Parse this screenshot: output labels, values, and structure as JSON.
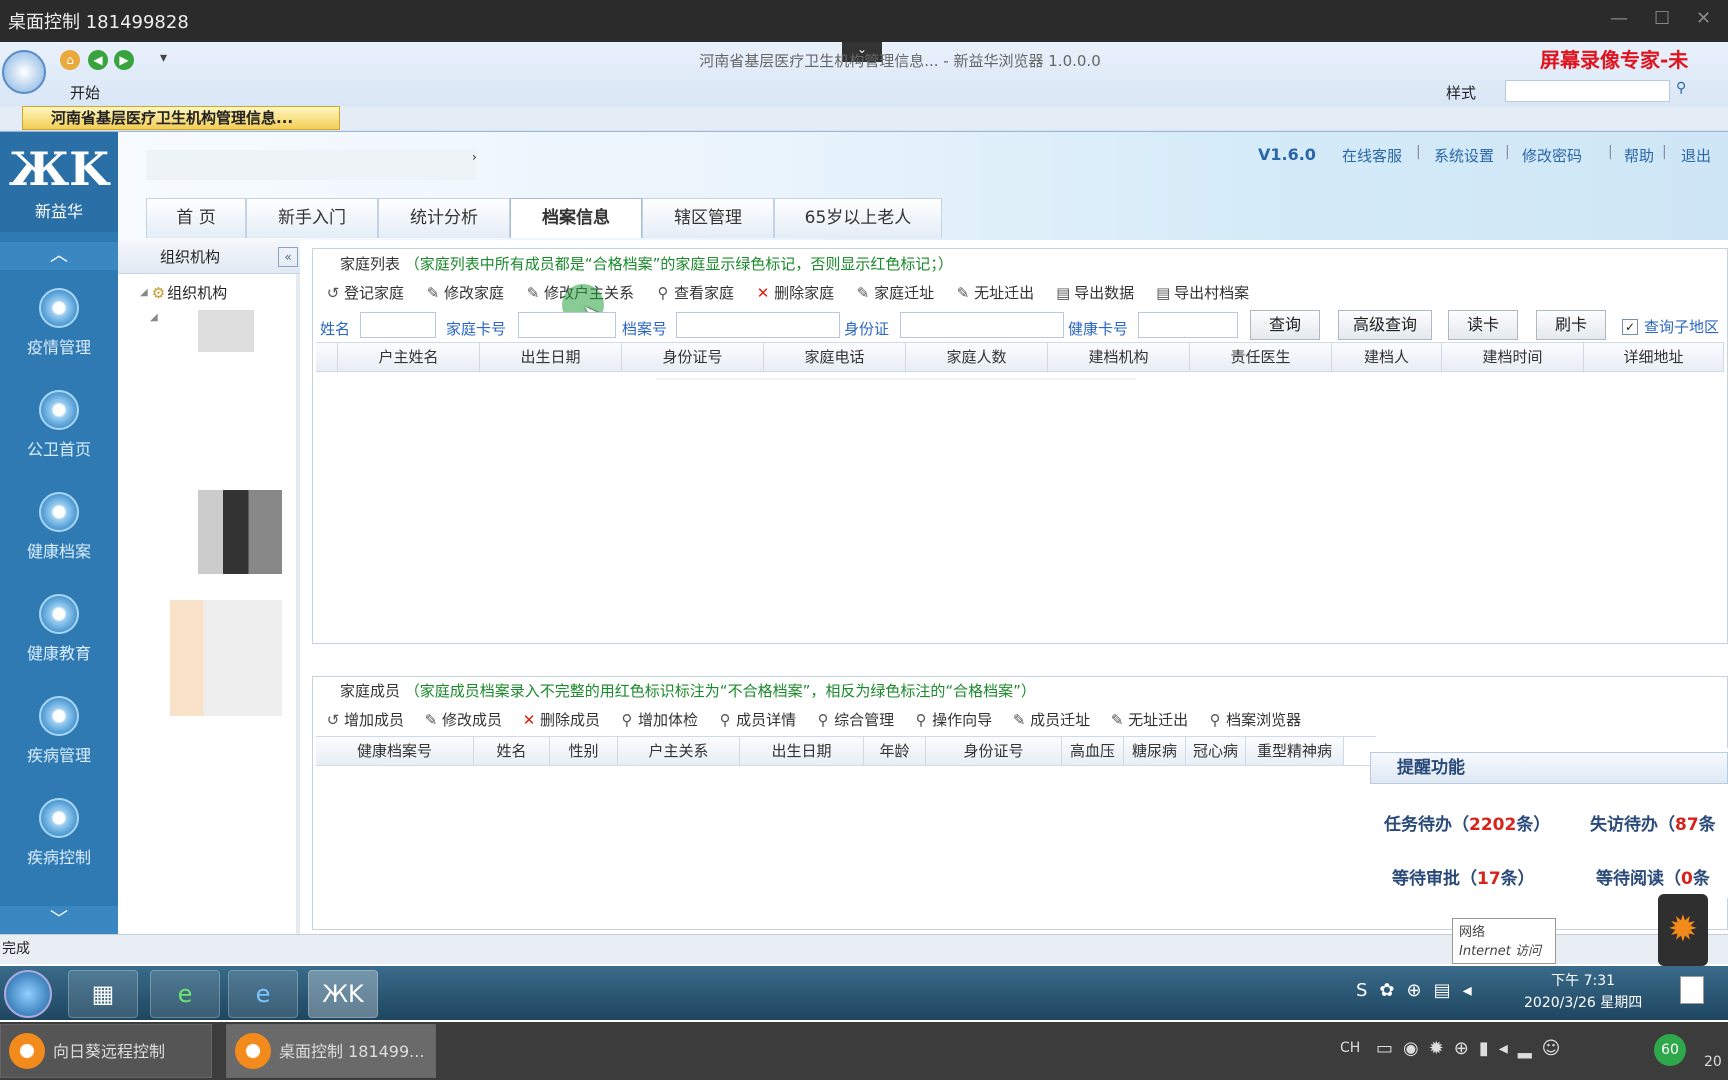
{
  "remote_title": "桌面控制 181499828",
  "browser": {
    "page_title": "河南省基层医疗卫生机构管理信息... - 新益华浏览器 1.0.0.0",
    "start_label": "开始",
    "style_label": "样式",
    "doc_tab": "河南省基层医疗卫生机构管理信息...",
    "recorder_watermark": "屏幕录像专家-未"
  },
  "app": {
    "version": "V1.6.0",
    "top_links": [
      "在线客服",
      "系统设置",
      "修改密码",
      "帮助",
      "退出"
    ],
    "logo_name": "新益华",
    "tabs": [
      "首 页",
      "新手入门",
      "统计分析",
      "档案信息",
      "辖区管理",
      "65岁以上老人"
    ],
    "active_tab": "档案信息",
    "sidebar": [
      "疫情管理",
      "公卫首页",
      "健康档案",
      "健康教育",
      "疾病管理",
      "疾病控制"
    ],
    "tree_title": "组织机构",
    "tree_root": "组织机构"
  },
  "family_list": {
    "title": "家庭列表",
    "hint": "（家庭列表中所有成员都是“合格档案”的家庭显示绿色标记，否则显示红色标记；）",
    "toolbar": [
      "登记家庭",
      "修改家庭",
      "修改户主关系",
      "查看家庭",
      "删除家庭",
      "家庭迁址",
      "无址迁出",
      "导出数据",
      "导出村档案"
    ],
    "search_labels": [
      "姓名",
      "家庭卡号",
      "档案号",
      "身份证",
      "健康卡号"
    ],
    "buttons": [
      "查询",
      "高级查询",
      "读卡",
      "刷卡"
    ],
    "sub_area": "查询子地区",
    "columns": [
      "户主姓名",
      "出生日期",
      "身份证号",
      "家庭电话",
      "家庭人数",
      "建档机构",
      "责任医生",
      "建档人",
      "建档时间",
      "详细地址"
    ]
  },
  "family_members": {
    "title": "家庭成员",
    "hint": "（家庭成员档案录入不完整的用红色标识标注为“不合格档案”，相反为绿色标注的“合格档案”）",
    "toolbar": [
      "增加成员",
      "修改成员",
      "删除成员",
      "增加体检",
      "成员详情",
      "综合管理",
      "操作向导",
      "成员迁址",
      "无址迁出",
      "档案浏览器"
    ],
    "columns": [
      "健康档案号",
      "姓名",
      "性别",
      "户主关系",
      "出生日期",
      "年龄",
      "身份证号",
      "高血压",
      "糖尿病",
      "冠心病",
      "重型精神病"
    ]
  },
  "reminder": {
    "title": "提醒功能",
    "task_label": "任务待办（",
    "task_num": "2202",
    "task_suffix": "条）",
    "lost_label": "失访待办（",
    "lost_num": "87",
    "lost_suffix": "条",
    "approve_label": "等待审批（",
    "approve_num": "17",
    "approve_suffix": "条）",
    "read_label": "等待阅读（",
    "read_num": "0",
    "read_suffix": "条"
  },
  "status": "完成",
  "net_tip": {
    "line1": "网络",
    "line2": "Internet 访问"
  },
  "clock": {
    "time": "下午 7:31",
    "date": "2020/3/26 星期四"
  },
  "taskbar2": {
    "app1": "向日葵远程控制",
    "app2": "桌面控制 181499...",
    "ime": "CH",
    "badge": "60",
    "year_frag": "20"
  }
}
